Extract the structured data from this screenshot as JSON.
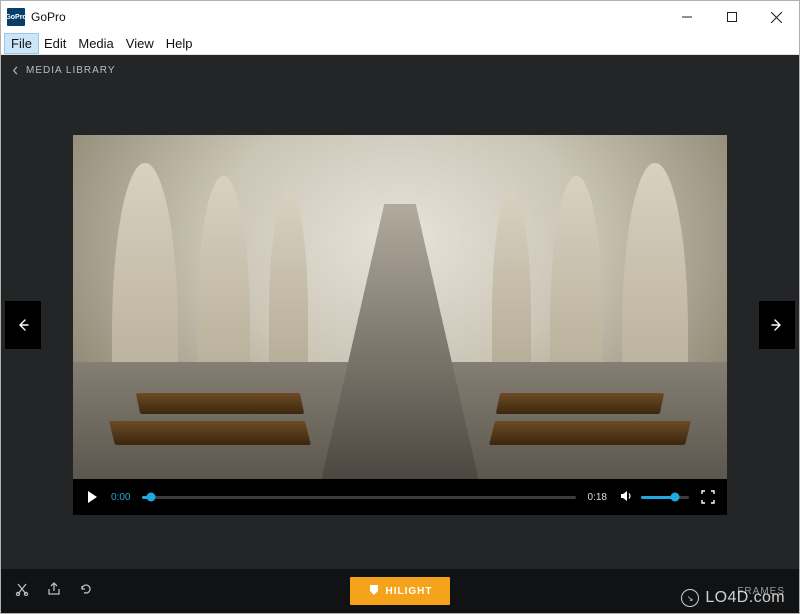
{
  "window": {
    "title": "GoPro"
  },
  "menu": {
    "items": [
      "File",
      "Edit",
      "Media",
      "View",
      "Help"
    ]
  },
  "breadcrumb": {
    "label": "MEDIA LIBRARY"
  },
  "player": {
    "current_time": "0:00",
    "duration": "0:18",
    "progress_percent": 2,
    "volume_percent": 70
  },
  "actions": {
    "hilight_label": "HILIGHT",
    "frames_label": "FRAMES"
  },
  "watermark": {
    "text": "LO4D.com"
  },
  "colors": {
    "accent": "#1fa9e0",
    "hilight": "#f5a31b",
    "bg_dark": "#232527"
  }
}
